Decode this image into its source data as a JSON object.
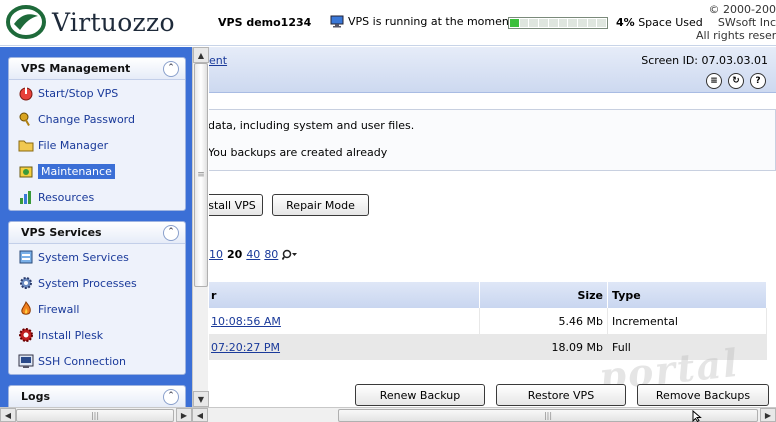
{
  "header": {
    "logo_text": "Virtuozzo",
    "vps_name": "VPS demo1234",
    "status_text": "VPS is running at the moment",
    "space_percent": "4%",
    "space_label": "Space Used",
    "space_fraction": 0.04,
    "copyright_line1": "© 2000-200",
    "copyright_line2": "SWsoft Inc",
    "copyright_line3": "All rights reserve"
  },
  "sidebar": {
    "vps_management": {
      "title": "VPS Management",
      "items": [
        {
          "label": "Start/Stop VPS",
          "icon": "power-icon"
        },
        {
          "label": "Change Password",
          "icon": "key-icon"
        },
        {
          "label": "File Manager",
          "icon": "folder-icon"
        },
        {
          "label": "Maintenance",
          "icon": "maintenance-icon"
        },
        {
          "label": "Resources",
          "icon": "chart-icon"
        }
      ]
    },
    "vps_services": {
      "title": "VPS Services",
      "items": [
        {
          "label": "System Services",
          "icon": "services-icon"
        },
        {
          "label": "System Processes",
          "icon": "gear-icon"
        },
        {
          "label": "Firewall",
          "icon": "firewall-icon"
        },
        {
          "label": "Install Plesk",
          "icon": "plesk-icon"
        },
        {
          "label": "SSH Connection",
          "icon": "terminal-icon"
        }
      ]
    },
    "logs": {
      "title": "Logs"
    }
  },
  "main": {
    "breadcrumb": "ent",
    "screen_id": "Screen ID: 07.03.03.01",
    "info_line1": "data, including system and user files.",
    "info_line2": "You backups are created already",
    "buttons": {
      "install_vps": "stall VPS",
      "repair_mode": "Repair Mode",
      "renew_backup": "Renew Backup",
      "restore_vps": "Restore VPS",
      "remove_backups": "Remove Backups"
    },
    "pager": {
      "p10": "10",
      "p20": "20",
      "p40": "40",
      "p80": "80"
    },
    "table": {
      "col_date": "r",
      "col_size": "Size",
      "col_type": "Type",
      "rows": [
        {
          "date": "10:08:56 AM",
          "size": "5.46 Mb",
          "type": "Incremental"
        },
        {
          "date": "07:20:27 PM",
          "size": "18.09 Mb",
          "type": "Full"
        }
      ]
    }
  },
  "watermark": "portal"
}
